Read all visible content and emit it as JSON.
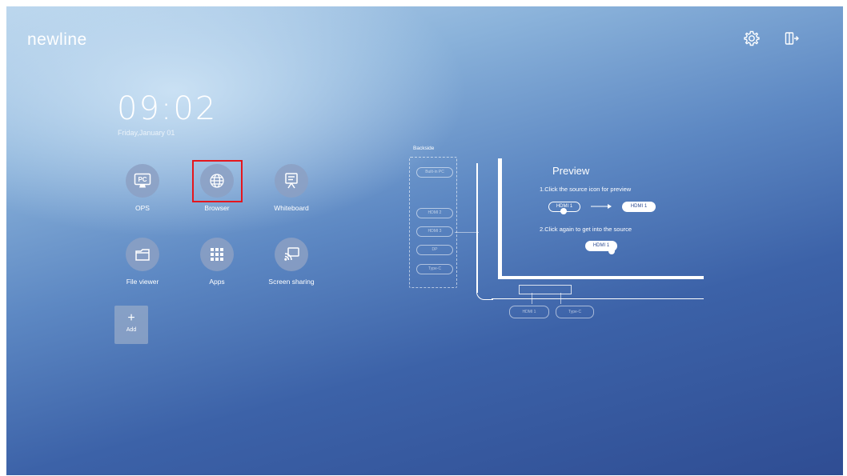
{
  "header": {
    "logo": "newline",
    "icons": [
      "settings-gear-icon",
      "exit-icon"
    ]
  },
  "clock": {
    "time": "09:02",
    "date": "Friday,January 01"
  },
  "apps": [
    {
      "label": "OPS",
      "icon": "pc-icon"
    },
    {
      "label": "Browser",
      "icon": "globe-icon"
    },
    {
      "label": "Whiteboard",
      "icon": "whiteboard-icon"
    },
    {
      "label": "File viewer",
      "icon": "folder-icon"
    },
    {
      "label": "Apps",
      "icon": "grid-icon"
    },
    {
      "label": "Screen sharing",
      "icon": "cast-icon"
    }
  ],
  "add": {
    "symbol": "+",
    "label": "Add"
  },
  "pc_badge": "PC",
  "diagram": {
    "backside_title": "Backside",
    "backside_ports": [
      "Built-in PC",
      "HDMI 2",
      "HDMI 3",
      "DP",
      "Type-C"
    ],
    "preview_title": "Preview",
    "step1": "1.Click the source icon for preview",
    "step2": "2.Click again to get into the source",
    "source_a": "HDMI 1",
    "source_b": "HDMI 1",
    "source_c": "HDMI 1",
    "front_ports": [
      "HDMI 1",
      "Type-C"
    ]
  },
  "colors": {
    "highlight": "#e5161d",
    "background_dark": "#2f4d93",
    "background_light": "#b8d4ec"
  }
}
